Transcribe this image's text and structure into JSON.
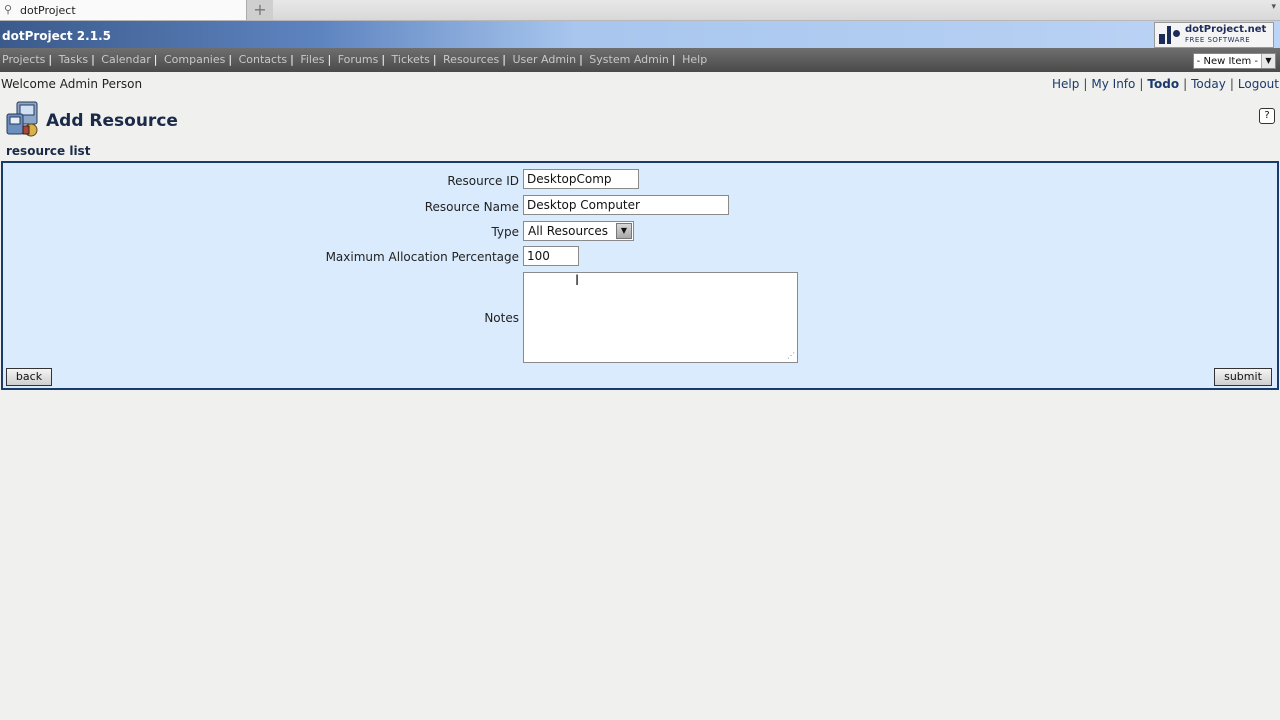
{
  "browser": {
    "tab_title": "dotProject",
    "new_tab_symbol": "+",
    "scroll_symbol": "▾"
  },
  "app": {
    "title": "dotProject 2.1.5",
    "logo_line1": "dotProject.net",
    "logo_line2": "FREE SOFTWARE"
  },
  "nav": {
    "items": [
      "Projects",
      "Tasks",
      "Calendar",
      "Companies",
      "Contacts",
      "Files",
      "Forums",
      "Tickets",
      "Resources",
      "User Admin",
      "System Admin",
      "Help"
    ],
    "new_item_label": "- New Item -"
  },
  "welcome": "Welcome Admin Person",
  "user_menu": {
    "help": "Help",
    "my_info": "My Info",
    "todo": "Todo",
    "today": "Today",
    "logout": "Logout"
  },
  "page": {
    "title": "Add Resource",
    "breadcrumb": "resource list"
  },
  "form": {
    "resource_id_label": "Resource ID",
    "resource_id_value": "DesktopComp",
    "resource_name_label": "Resource Name",
    "resource_name_value": "Desktop Computer",
    "type_label": "Type",
    "type_value": "All Resources",
    "max_alloc_label": "Maximum Allocation Percentage",
    "max_alloc_value": "100",
    "notes_label": "Notes",
    "notes_value": "",
    "back_label": "back",
    "submit_label": "submit"
  },
  "colors": {
    "panel_bg": "#d9ebfd",
    "panel_border": "#1a3a6b",
    "nav_bg": "#555555",
    "header_accent": "#5e84c0"
  }
}
